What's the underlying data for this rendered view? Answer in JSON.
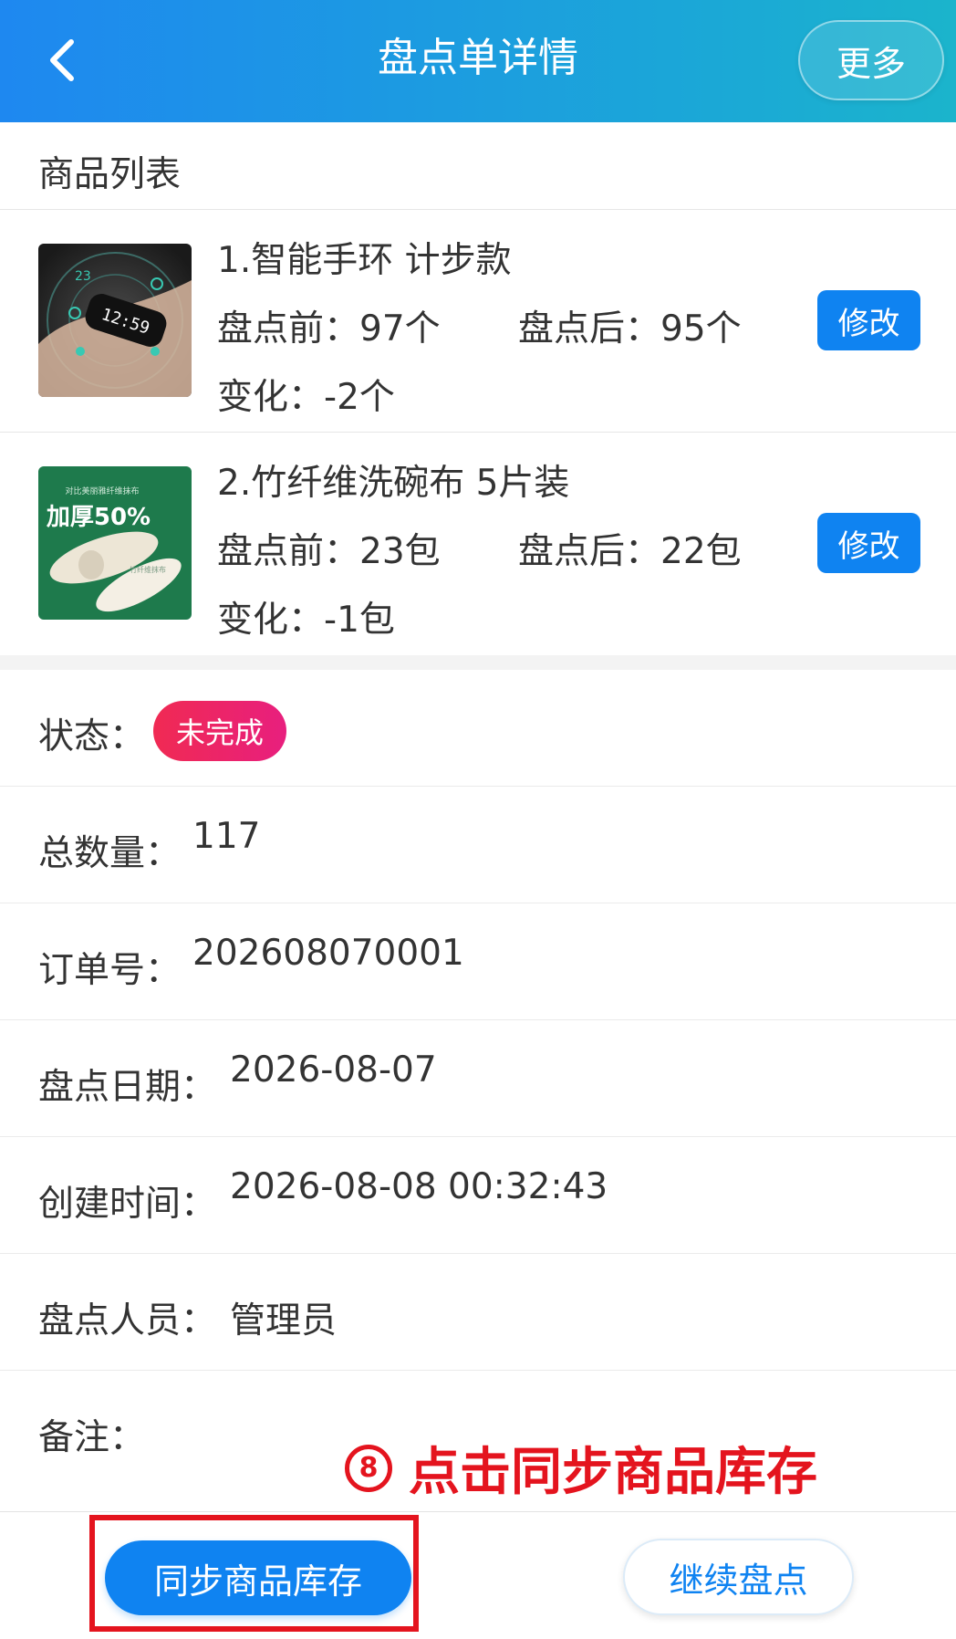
{
  "header": {
    "title": "盘点单详情",
    "more_label": "更多"
  },
  "products_section": {
    "title": "商品列表"
  },
  "products": [
    {
      "name": "1.智能手环 计步款",
      "before": "盘点前：97个",
      "after": "盘点后：95个",
      "change": "变化：-2个",
      "edit_label": "修改"
    },
    {
      "name": "2.竹纤维洗碗布 5片装",
      "before": "盘点前：23包",
      "after": "盘点后：22包",
      "change": "变化：-1包",
      "edit_label": "修改"
    }
  ],
  "thumb_texts": {
    "band_screen": "12:59",
    "band_steps": "23",
    "cloth_top": "对比美丽雅纤维抹布",
    "cloth_main": "加厚50%",
    "cloth_roll": "竹纤维抹布"
  },
  "info": {
    "status_label": "状态：",
    "status_value": "未完成",
    "total_label": "总数量：",
    "total_value": "117",
    "order_label": "订单号：",
    "order_value": "202608070001",
    "date_label": "盘点日期：",
    "date_value": "2026-08-07",
    "created_label": "创建时间：",
    "created_value": "2026-08-08 00:32:43",
    "staff_label": "盘点人员：",
    "staff_value": "管理员",
    "remark_label": "备注：",
    "remark_value": ""
  },
  "annotation": {
    "number": "8",
    "text": "点击同步商品库存"
  },
  "buttons": {
    "sync_label": "同步商品库存",
    "continue_label": "继续盘点"
  },
  "colors": {
    "primary": "#0f83f1",
    "header_start": "#1e88f0",
    "header_end": "#1bb4cc",
    "status_badge": "#f02a53",
    "annotation": "#e4141e"
  }
}
